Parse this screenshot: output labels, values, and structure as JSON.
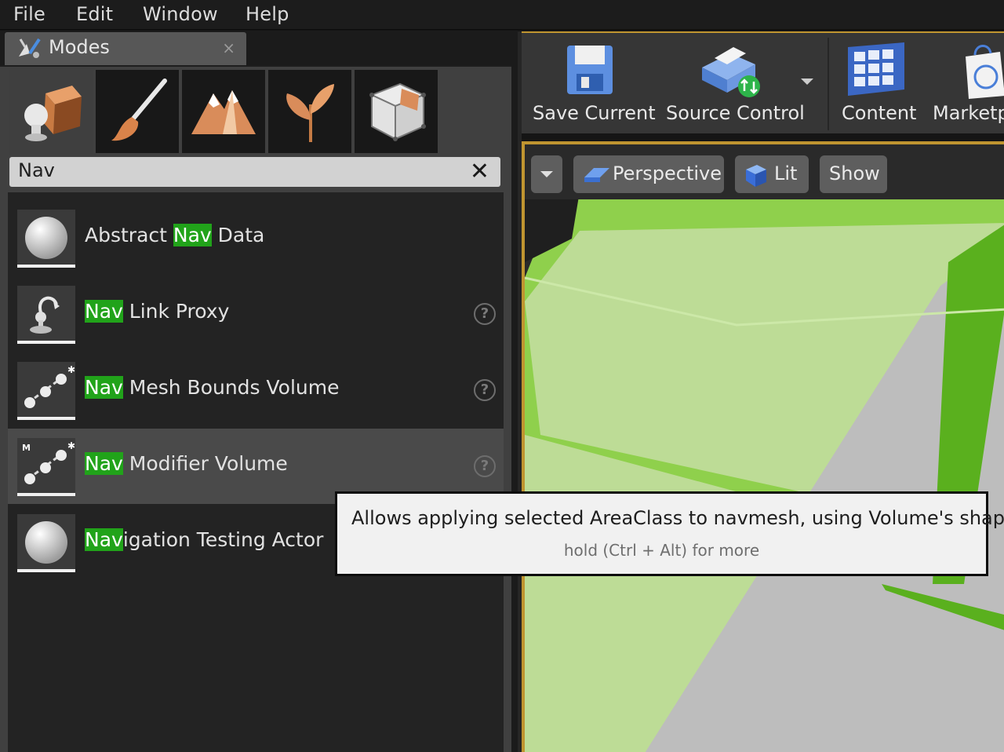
{
  "menu": {
    "items": [
      {
        "label": "File"
      },
      {
        "label": "Edit"
      },
      {
        "label": "Window"
      },
      {
        "label": "Help"
      }
    ]
  },
  "modes_tab": {
    "title": "Modes",
    "close": "×"
  },
  "modes": [
    {
      "name": "place",
      "icon": "place-mode-icon",
      "active": true
    },
    {
      "name": "paint",
      "icon": "paintbrush-icon",
      "active": false
    },
    {
      "name": "landscape",
      "icon": "mountain-icon",
      "active": false
    },
    {
      "name": "foliage",
      "icon": "foliage-leaf-icon",
      "active": false
    },
    {
      "name": "geometry",
      "icon": "geometry-cube-icon",
      "active": false
    }
  ],
  "search": {
    "value": "Nav",
    "clear": "✕"
  },
  "items": [
    {
      "before": "Abstract ",
      "match": "Nav",
      "after": " Data",
      "icon": "sphere-icon",
      "help": false
    },
    {
      "before": "",
      "match": "Nav",
      "after": " Link Proxy",
      "icon": "nav-link-proxy-icon",
      "help": true
    },
    {
      "before": "",
      "match": "Nav",
      "after": " Mesh Bounds Volume",
      "icon": "volume-icon",
      "help": true
    },
    {
      "before": "",
      "match": "Nav",
      "after": " Modifier Volume",
      "icon": "modifier-volume-icon",
      "help": true,
      "selected": true
    },
    {
      "before": "",
      "match": "Nav",
      "after": "igation Testing Actor",
      "icon": "sphere-icon",
      "help": false
    }
  ],
  "help_glyph": "?",
  "modifier_badge": "M",
  "toolbar": {
    "save_label": "Save Current",
    "source_label": "Source Control",
    "content_label": "Content",
    "market_label": "Marketp"
  },
  "viewport": {
    "perspective_label": "Perspective",
    "lit_label": "Lit",
    "show_label": "Show"
  },
  "tooltip": {
    "main": "Allows applying selected AreaClass to navmesh, using Volume's shape",
    "sub": "hold (Ctrl + Alt) for more"
  },
  "colors": {
    "highlight": "#21a31a",
    "accent": "#c09530",
    "ground": "#7fc93a"
  }
}
